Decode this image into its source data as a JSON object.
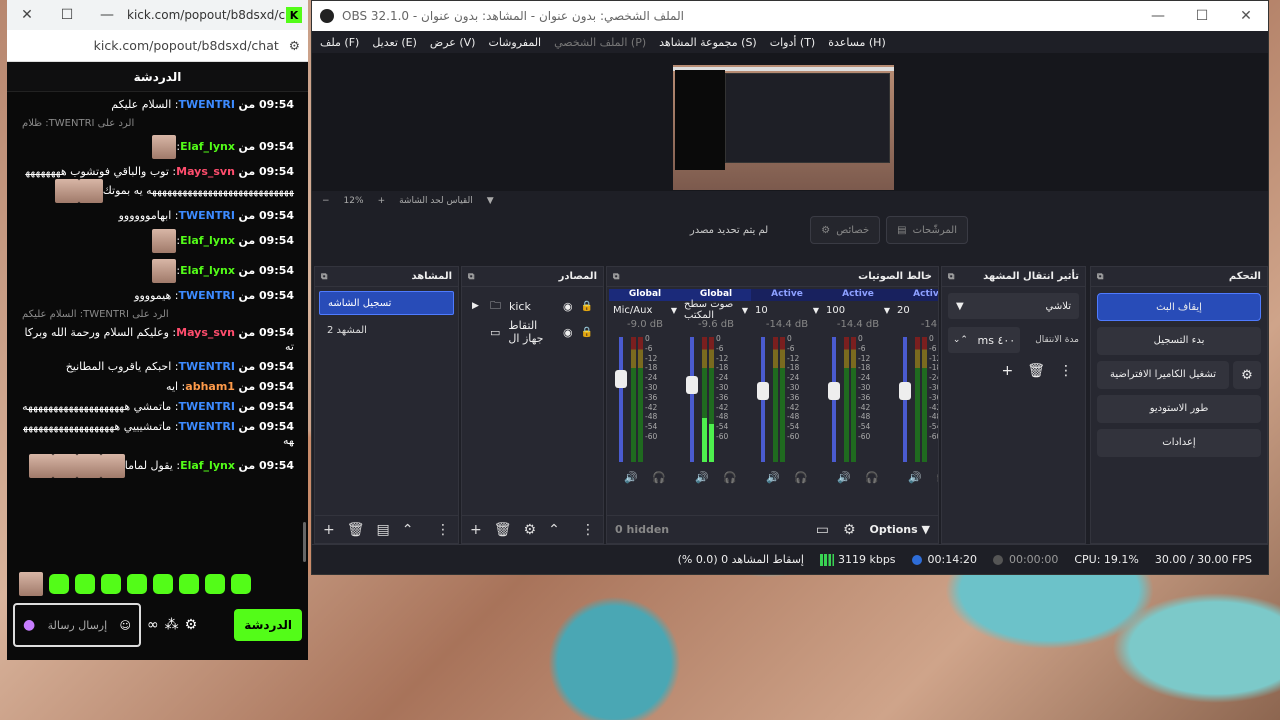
{
  "chat": {
    "window_title": "kick.com/popout/b8dsxd/c...",
    "url": "kick.com/popout/b8dsxd/chat",
    "header": "الدردشة",
    "reply_prefix": "الرد على",
    "messages": [
      {
        "time": "09:54 من",
        "user": "TWENTRI",
        "user_color": "#3d8bff",
        "text": ": السلام عليكم"
      },
      {
        "type": "reply",
        "text": "الرد على TWENTRI: ظلام"
      },
      {
        "time": "09:54 من",
        "user": "Elaf_lynx",
        "user_color": "#53fc18",
        "text": ":",
        "emotes": 1
      },
      {
        "time": "09:54 من",
        "user": "Mays_svn",
        "user_color": "#ff4d6d",
        "text": ": توب والباقي فوتشوب ههههههههههههههههههههههههههههههههههههه يه بموتك",
        "emotes": 2
      },
      {
        "time": "09:54 من",
        "user": "TWENTRI",
        "user_color": "#3d8bff",
        "text": ": ابهاموووووو"
      },
      {
        "time": "09:54 من",
        "user": "Elaf_lynx",
        "user_color": "#53fc18",
        "text": ":",
        "emotes": 1
      },
      {
        "time": "09:54 من",
        "user": "Elaf_lynx",
        "user_color": "#53fc18",
        "text": ":",
        "emotes": 1
      },
      {
        "time": "09:54 من",
        "user": "TWENTRI",
        "user_color": "#3d8bff",
        "text": ": هيموووو"
      },
      {
        "type": "reply",
        "text": "الرد على TWENTRI: السلام عليكم"
      },
      {
        "time": "09:54 من",
        "user": "Mays_svn",
        "user_color": "#ff4d6d",
        "text": ": وعليكم السلام ورحمة الله وبركاته"
      },
      {
        "time": "09:54 من",
        "user": "TWENTRI",
        "user_color": "#3d8bff",
        "text": ": احبكم ياقروب المطانيخ"
      },
      {
        "time": "09:54 من",
        "user": "abham1",
        "user_color": "#ff9b4a",
        "text": ": ايه"
      },
      {
        "time": "09:54 من",
        "user": "TWENTRI",
        "user_color": "#3d8bff",
        "text": ": ماتمشي ههههههههههههههههههههه"
      },
      {
        "time": "09:54 من",
        "user": "TWENTRI",
        "user_color": "#3d8bff",
        "text": ": ماتمشيييي ههههههههههههههههههههه"
      },
      {
        "time": "09:54 من",
        "user": "Elaf_lynx",
        "user_color": "#53fc18",
        "text": ": يقول لماما",
        "emotes": 4
      }
    ],
    "input_placeholder": "إرسال رسالة",
    "send_button": "الدردشة"
  },
  "obs": {
    "window_title": "OBS 32.1.0 - الملف الشخصي: بدون عنوان - المشاهد: بدون عنوان",
    "menu": [
      {
        "label": "ملف (F)",
        "disabled": false
      },
      {
        "label": "تعديل (E)",
        "disabled": false
      },
      {
        "label": "عرض (V)",
        "disabled": false
      },
      {
        "label": "المفروشات",
        "disabled": false
      },
      {
        "label": "الملف الشخصي (P)",
        "disabled": true
      },
      {
        "label": "مجموعة المشاهد (S)",
        "disabled": false
      },
      {
        "label": "أدوات (T)",
        "disabled": false
      },
      {
        "label": "مساعدة (H)",
        "disabled": false
      }
    ],
    "zoom": "12%",
    "zoom_label": "القياس لحد الشاشة",
    "no_source_selected": "لم يتم تحديد مصدر",
    "properties_button": "خصائص",
    "filters_button": "المرشّحات",
    "scenes": {
      "title": "المشاهد",
      "items": [
        {
          "label": "تسجيل الشاشه",
          "active": true
        },
        {
          "label": "المشهد 2",
          "active": false
        }
      ]
    },
    "sources": {
      "title": "المصادر",
      "items": [
        {
          "label": "kick",
          "icon": "folder-icon"
        },
        {
          "label": "التقاط جهاز ال",
          "icon": "monitor-icon"
        }
      ]
    },
    "mixer": {
      "title": "خالط الصوتيات",
      "hidden_label": "0 hidden",
      "options_label": "Options",
      "channels": [
        {
          "status": "Global",
          "name": "Mic/Aux",
          "db": "-9.0 dB",
          "fader": 0.66,
          "level_l": 0.0,
          "level_r": 0.0,
          "muted": true
        },
        {
          "status": "Global",
          "name": "صوت سطح المكتب",
          "db": "-9.6 dB",
          "fader": 0.62,
          "level_l": 0.35,
          "level_r": 0.3,
          "muted": false
        },
        {
          "status": "Active",
          "name": "10",
          "db": "-14.4 dB",
          "fader": 0.57,
          "level_l": 0.0,
          "level_r": 0.0,
          "muted": false
        },
        {
          "status": "Active",
          "name": "100",
          "db": "-14.4 dB",
          "fader": 0.57,
          "level_l": 0.0,
          "level_r": 0.0,
          "muted": false
        },
        {
          "status": "Active",
          "name": "20",
          "db": "-14",
          "fader": 0.57,
          "level_l": 0.0,
          "level_r": 0.0,
          "muted": false
        }
      ],
      "scale": [
        "0",
        "-6",
        "-12",
        "-18",
        "-24",
        "-30",
        "-36",
        "-42",
        "-48",
        "-54",
        "-60"
      ]
    },
    "transitions": {
      "title": "تأثير انتقال المشهد",
      "selected": "تلاشي",
      "duration_label": "مدة الانتقال",
      "duration_value": "٤٠٠ ms"
    },
    "controls": {
      "title": "التحكم",
      "stop_stream": "إيقاف البث",
      "start_recording": "بدء التسجيل",
      "virtual_camera": "تشغيل الكاميرا الافتراضية",
      "studio_mode": "طور الاستوديو",
      "settings": "إعدادات"
    },
    "status": {
      "dropped": "إسقاط المشاهد 0 (0.0 %)",
      "bitrate": "3119 kbps",
      "stream_time": "00:14:20",
      "rec_time": "00:00:00",
      "cpu": "CPU: 19.1%",
      "fps": "30.00 / 30.00 FPS"
    }
  }
}
